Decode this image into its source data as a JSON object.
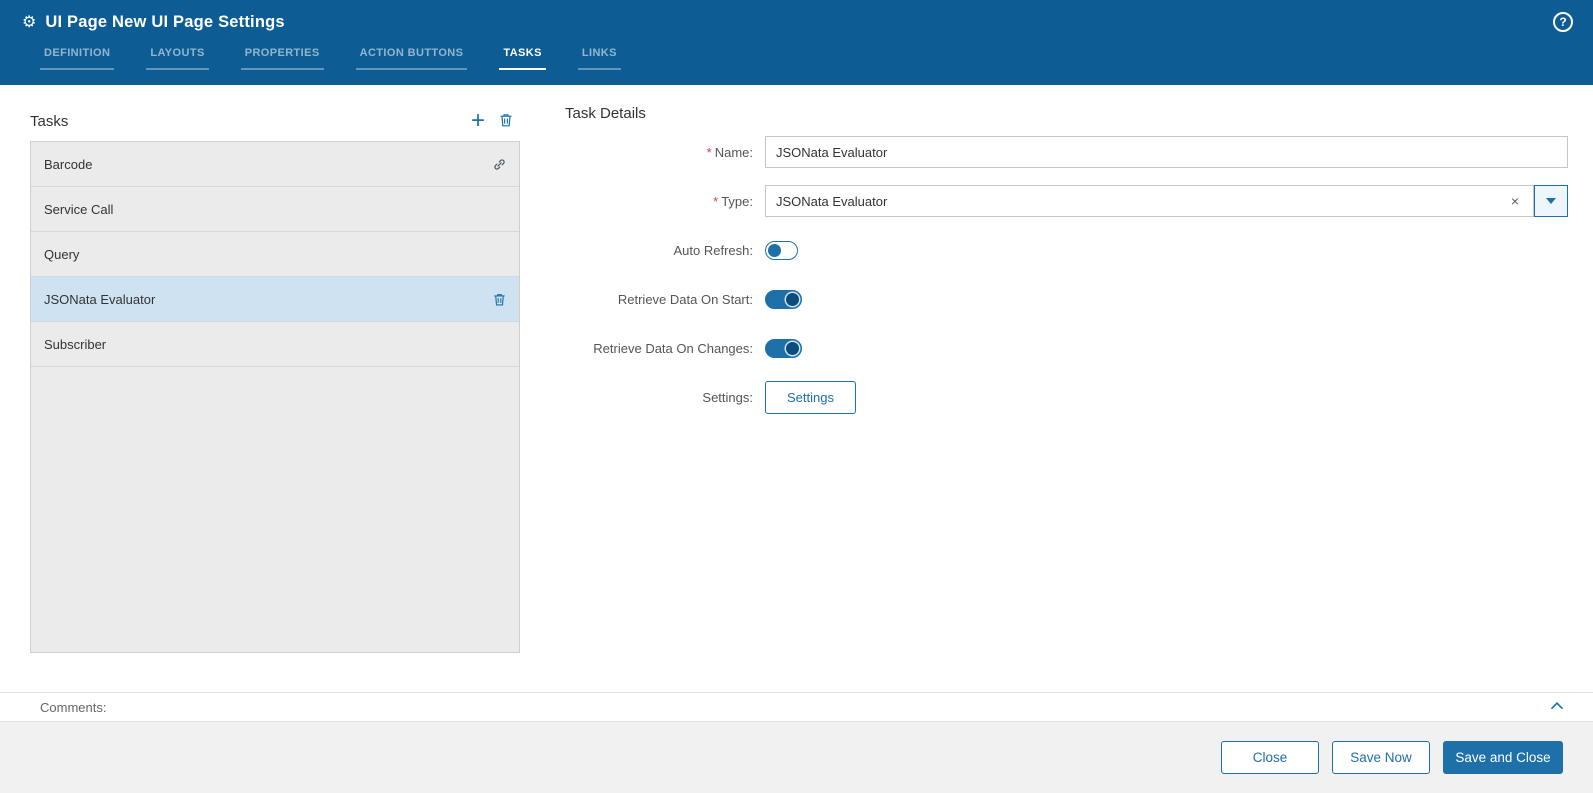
{
  "header": {
    "title": "UI Page New UI Page Settings",
    "tabs": [
      "DEFINITION",
      "LAYOUTS",
      "PROPERTIES",
      "ACTION BUTTONS",
      "TASKS",
      "LINKS"
    ],
    "active_tab": "TASKS"
  },
  "icons": {
    "gear": "⚙",
    "help": "?",
    "add": "+",
    "clear": "×"
  },
  "tasks": {
    "title": "Tasks",
    "selected": "JSONata Evaluator",
    "items": [
      {
        "label": "Barcode"
      },
      {
        "label": "Service Call"
      },
      {
        "label": "Query"
      },
      {
        "label": "JSONata Evaluator"
      },
      {
        "label": "Subscriber"
      }
    ]
  },
  "details": {
    "title": "Task Details",
    "required_marker": "*",
    "name": {
      "label": "Name:",
      "value": "JSONata Evaluator"
    },
    "type": {
      "label": "Type:",
      "value": "JSONata Evaluator"
    },
    "auto_refresh": {
      "label": "Auto Refresh:",
      "on": false
    },
    "retrieve_start": {
      "label": "Retrieve Data On Start:",
      "on": true
    },
    "retrieve_changes": {
      "label": "Retrieve Data On Changes:",
      "on": true
    },
    "settings": {
      "label": "Settings:",
      "button": "Settings"
    }
  },
  "comments": {
    "label": "Comments:"
  },
  "footer": {
    "close": "Close",
    "save_now": "Save Now",
    "save_and_close": "Save and Close"
  },
  "colors": {
    "header_bg": "#0d5c94",
    "accent": "#1d70a8",
    "selected_row_bg": "#cfe2f2"
  }
}
